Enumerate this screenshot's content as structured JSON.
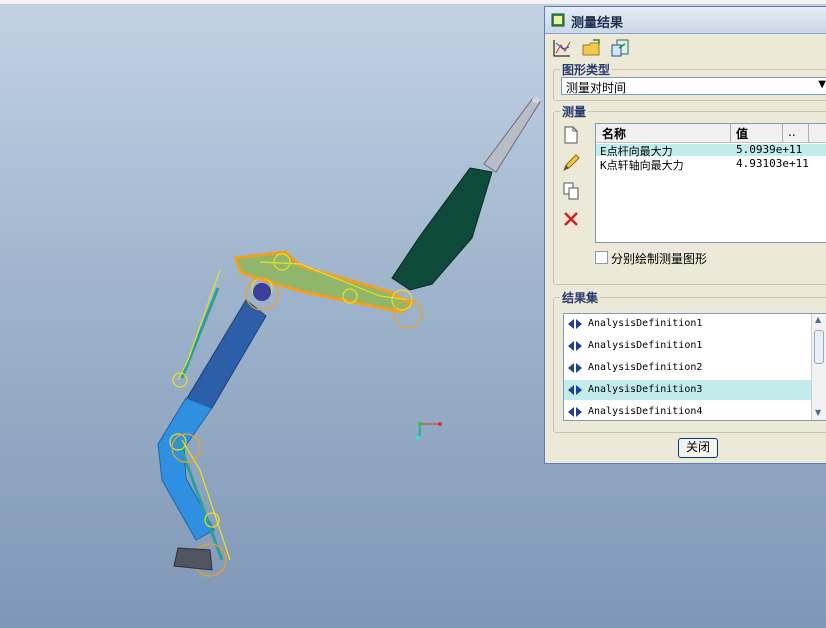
{
  "dialog": {
    "title": "测量结果",
    "graph_type_label": "图形类型",
    "graph_type_value": "测量对时间",
    "measure_label": "测量",
    "table": {
      "headers": [
        "名称",
        "值",
        ".."
      ],
      "rows": [
        {
          "name": "E点杆向最大力",
          "value": "5.0939e+11",
          "selected": true
        },
        {
          "name": "K点轩轴向最大力",
          "value": "4.93103e+11",
          "selected": false
        }
      ]
    },
    "separate_plot_label": "分别绘制测量图形",
    "result_set_label": "结果集",
    "result_sets": [
      {
        "label": "AnalysisDefinition1",
        "selected": false
      },
      {
        "label": "AnalysisDefinition1",
        "selected": false
      },
      {
        "label": "AnalysisDefinition2",
        "selected": false
      },
      {
        "label": "AnalysisDefinition3",
        "selected": true
      },
      {
        "label": "AnalysisDefinition4",
        "selected": false
      }
    ],
    "close_label": "关闭"
  },
  "colors": {
    "selection": "#c2ecec",
    "boom_blue": "#2f8fe0",
    "arm_orange": "#f0a020",
    "hammer_green": "#0e4a3a"
  },
  "icons": [
    "graph-icon",
    "open-folder-icon",
    "export-icon",
    "new-doc-icon",
    "edit-pencil-icon",
    "copy-icon",
    "delete-x-icon"
  ]
}
